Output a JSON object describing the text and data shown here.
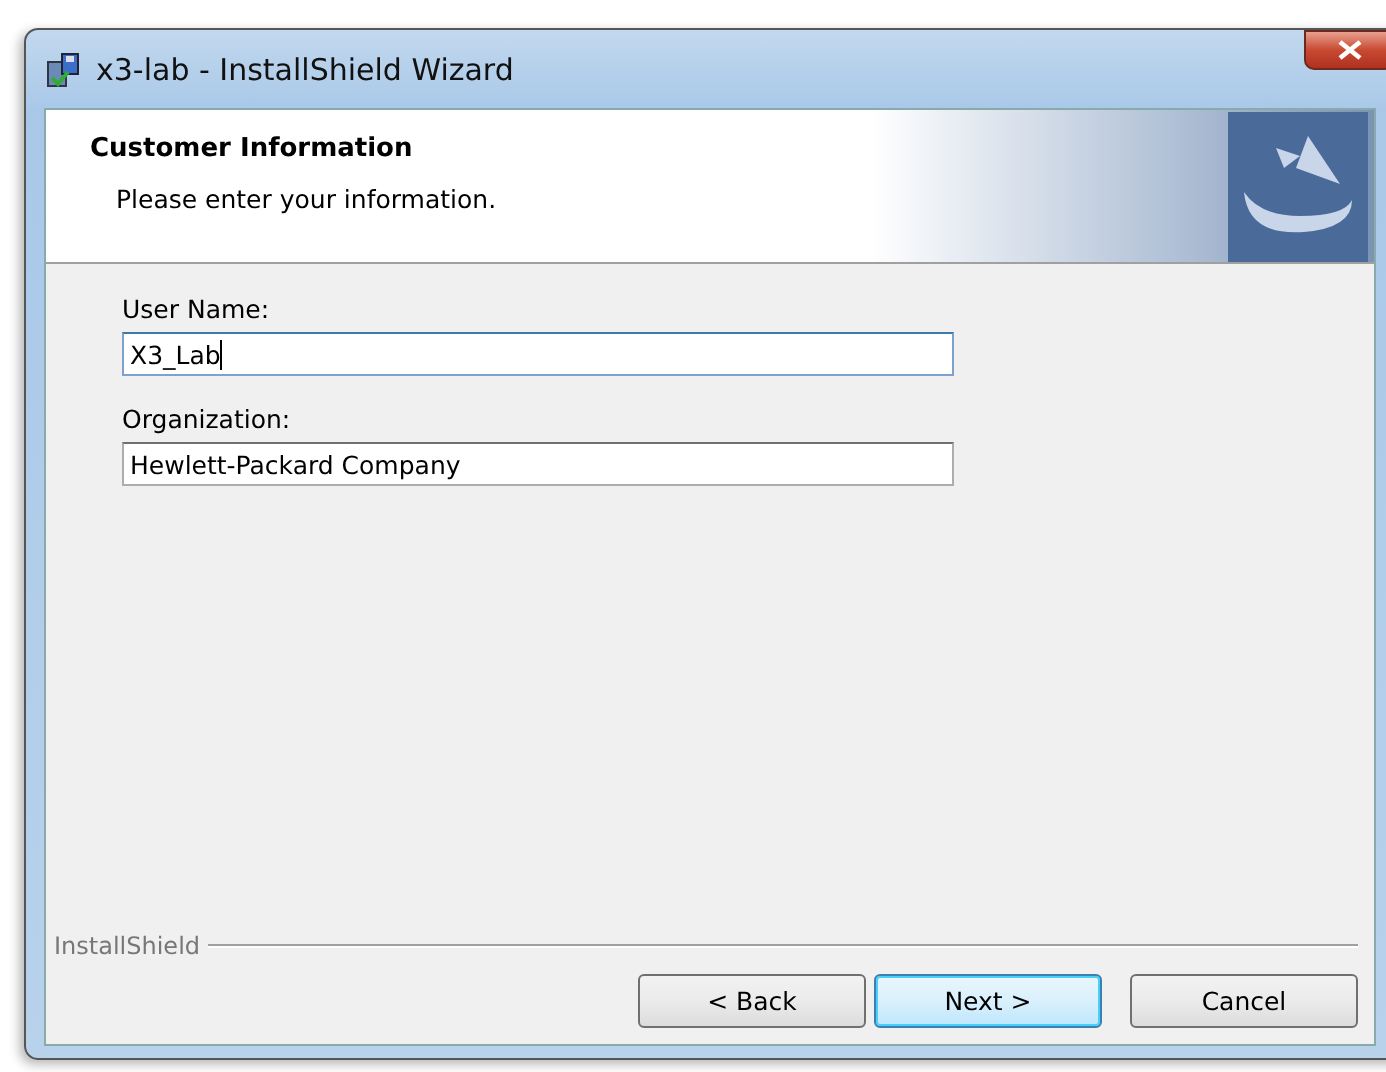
{
  "window": {
    "title": "x3-lab - InstallShield Wizard"
  },
  "header": {
    "title": "Customer Information",
    "subtitle": "Please enter your information."
  },
  "fields": [
    {
      "label": "User Name:",
      "value": "X3_Lab",
      "focused": true
    },
    {
      "label": "Organization:",
      "value": "Hewlett-Packard Company",
      "focused": false
    }
  ],
  "footer": {
    "brand": "InstallShield"
  },
  "buttons": [
    {
      "label": "< Back",
      "default": false
    },
    {
      "label": "Next >",
      "default": true
    },
    {
      "label": "Cancel",
      "default": false
    }
  ]
}
